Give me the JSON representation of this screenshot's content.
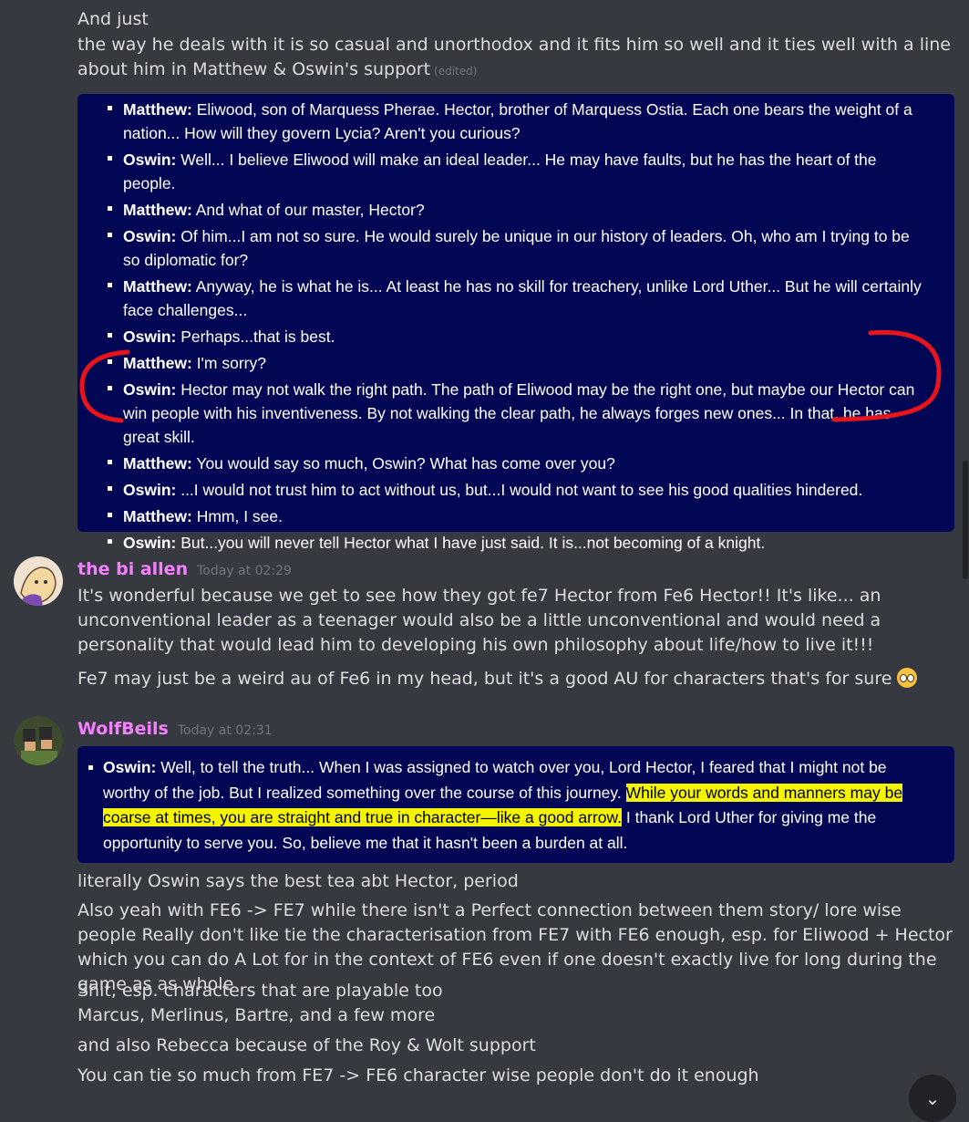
{
  "top_message": {
    "line1": "And just",
    "line2": "the way he deals with it is so casual and unorthodox and it fits him so well and it ties well with a line about him in Matthew & Oswin's support",
    "edited": "(edited)"
  },
  "support_embed": [
    {
      "speaker": "Matthew:",
      "text": " Eliwood, son of Marquess Pherae. Hector, brother of Marquess Ostia. Each one bears the weight of a nation... How will they govern Lycia? Aren't you curious?"
    },
    {
      "speaker": "Oswin:",
      "text": " Well... I believe Eliwood will make an ideal leader... He may have faults, but he has the heart of the people."
    },
    {
      "speaker": "Matthew:",
      "text": " And what of our master, Hector?"
    },
    {
      "speaker": "Oswin:",
      "text": " Of him...I am not so sure. He would surely be unique in our history of leaders. Oh, who am I trying to be so diplomatic for?"
    },
    {
      "speaker": "Matthew:",
      "text": " Anyway, he is what he is... At least he has no skill for treachery, unlike Lord Uther... But he will certainly face challenges..."
    },
    {
      "speaker": "Oswin:",
      "text": " Perhaps...that is best."
    },
    {
      "speaker": "Matthew:",
      "text": " I'm sorry?"
    },
    {
      "speaker": "Oswin:",
      "text": " Hector may not walk the right path. The path of Eliwood may be the right one, but maybe our Hector can win people with his inventiveness. By not walking the clear path, he always forges new ones... In that, he has great skill."
    },
    {
      "speaker": "Matthew:",
      "text": " You would say so much, Oswin? What has come over you?"
    },
    {
      "speaker": "Oswin:",
      "text": " ...I would not trust him to act without us, but...I would not want to see his good qualities hindered."
    },
    {
      "speaker": "Matthew:",
      "text": " Hmm, I see."
    },
    {
      "speaker": "Oswin:",
      "text": " But...you will never tell Hector what I have just said. It is...not becoming of a knight."
    }
  ],
  "message_bi_allen": {
    "username": "the bi allen",
    "timestamp": "Today at 02:29",
    "line1": "It's wonderful because we get to see how they got fe7 Hector from Fe6 Hector!! It's like... an unconventional leader as a teenager would also be a little unconventional and would need a personality that would lead him to developing his own philosophy about life/how to live it!!!",
    "line2": "Fe7 may just be a weird au of Fe6 in my head, but it's a good AU for characters that's for sure"
  },
  "message_wolfbeils": {
    "username": "WolfBeils",
    "timestamp": "Today at 02:31",
    "embed_speaker": "Oswin:",
    "embed_text_a": " Well, to tell the truth... When I was assigned to watch over you, Lord Hector, I feared that I might not be worthy of the job. But I realized something over the course of this journey. ",
    "embed_highlight": "While your words and manners may be coarse at times, you are straight and true in character—like a good arrow.",
    "embed_text_b": " I thank Lord Uther for giving me the opportunity to serve you. So, believe me that it hasn't been a burden at all.",
    "lines": [
      "literally Oswin says the best tea abt  Hector, period",
      "Also yeah with FE6 -> FE7 while there isn't a Perfect connection between them story/ lore wise people Really don't like tie the characterisation from FE7 with FE6 enough, esp. for Eliwood + Hector which you can do A Lot for in the context of FE6 even if one doesn't exactly live for long during the game as as whole",
      "Shit, esp. characters that are playable too",
      "Marcus, Merlinus, Bartre, and a few more",
      "and also Rebecca because of the Roy & Wolt support",
      "You can tie so much from FE7 -> FE6 character wise people don't do it enough"
    ]
  },
  "colors": {
    "background": "#36393f",
    "username": "#f47fff",
    "embed_bg": "#020755",
    "highlight": "#f4f400",
    "annotation": "#e8141b"
  }
}
